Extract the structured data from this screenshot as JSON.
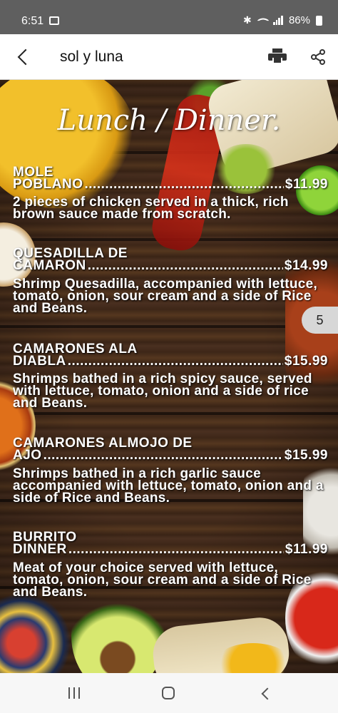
{
  "status_bar": {
    "time": "6:51",
    "battery": "86%"
  },
  "app_bar": {
    "title": "sol y luna"
  },
  "menu": {
    "title": "Lunch / Dinner.",
    "items": [
      {
        "name_line1": "MOLE",
        "name_line2": "POBLANO",
        "price": "$11.99",
        "desc": "2 pieces of chicken served in a thick, rich brown sauce  made from  scratch."
      },
      {
        "name_line1": "QUESADILLA DE",
        "name_line2": "CAMARON",
        "price": "$14.99",
        "desc": "Shrimp Quesadilla, accompanied with lettuce, tomato, onion, sour cream and a side of Rice and Beans."
      },
      {
        "name_line1": "CAMARONES ALA",
        "name_line2": "DIABLA",
        "price": "$15.99",
        "desc": "Shrimps bathed in a rich spicy sauce, served with lettuce, tomato, onion and a side of rice and Beans."
      },
      {
        "name_line1": "CAMARONES ALMOJO DE",
        "name_line2": "AJO",
        "price": "$15.99",
        "desc": "Shrimps bathed in a rich garlic sauce accompanied with lettuce, tomato, onion and a side of Rice and Beans."
      },
      {
        "name_line1": "BURRITO",
        "name_line2": "DINNER",
        "price": "$11.99",
        "desc": "Meat of your choice served with lettuce, tomato, onion, sour cream and a side of Rice and Beans."
      }
    ]
  },
  "page_badge": "5",
  "icons": {
    "back": "back-arrow-icon",
    "print": "print-icon",
    "share": "share-icon",
    "recents": "recents-icon",
    "home": "home-icon",
    "nav_back": "nav-back-icon"
  }
}
